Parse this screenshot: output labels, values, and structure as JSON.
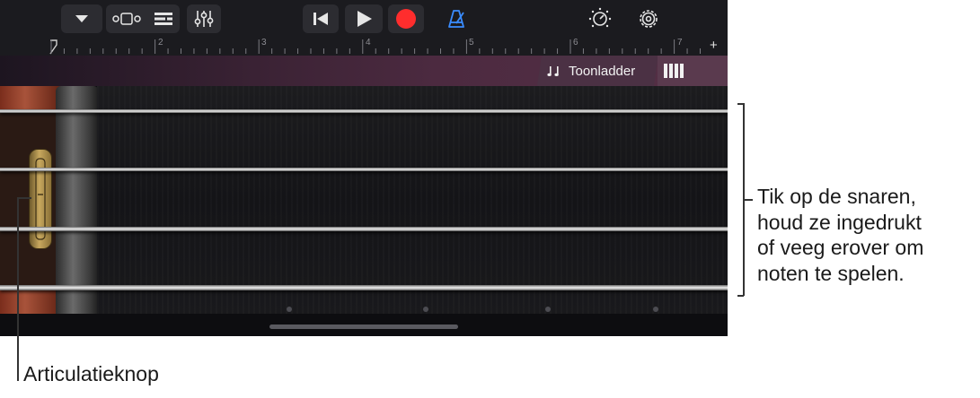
{
  "toolbar": {
    "tracks_view": "dropdown-icon",
    "smart_controls": "smart-controls-icon",
    "tracks": "tracks-view-icon",
    "mixer": "mixer-icon",
    "rewind": "skip-back-icon",
    "play": "play-icon",
    "record": "record-icon",
    "metronome": "metronome-icon",
    "master_volume": "volume-knob-icon",
    "settings": "gear-icon",
    "record_color": "#ff2d2d",
    "metronome_color": "#3a8cff"
  },
  "ruler": {
    "marks": [
      "2",
      "3",
      "4",
      "5",
      "6",
      "7"
    ],
    "add_label": "+"
  },
  "tabs": {
    "scale_label": "Toonladder",
    "notes_icon": "notes-view-icon"
  },
  "callouts": {
    "strings_text": "Tik op de snaren,\nhoud ze ingedrukt\nof veeg erover om\nnoten te spelen.",
    "knob_label": "Articulatieknop"
  }
}
